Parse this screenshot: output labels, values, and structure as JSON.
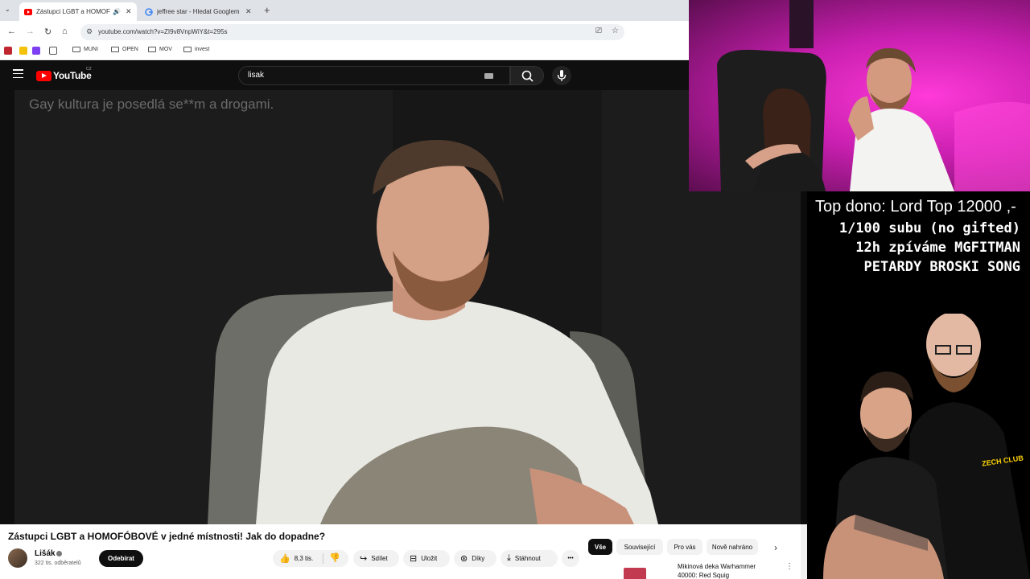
{
  "browser": {
    "tabs": [
      {
        "title": "Zástupci LGBT a HOMOFÓBOVÉ",
        "active": true
      },
      {
        "title": "jeffree star - Hledat Googlem",
        "active": false
      }
    ],
    "tab_list_icon": "chevron-down-icon",
    "new_tab_label": "+",
    "url": "youtube.com/watch?v=ZI9v8VnpWiY&t=295s",
    "bookmarks": [
      "MUNI",
      "OPEN",
      "MOV",
      "invest"
    ],
    "accent_colors": {
      "youtube_red": "#ff0000",
      "tab_bar": "#dfe3e8"
    }
  },
  "youtube": {
    "logo_text": "YouTube",
    "country_code": "CZ",
    "search_value": "lisak",
    "video_caption": "Gay kultura je posedlá se**m a drogami.",
    "video_title": "Zástupci LGBT a HOMOFÓBOVÉ v jedné místnosti! Jak do dopadne?",
    "channel_name": "Lišák",
    "subscriber_count": "322 tis. odběratelů",
    "subscribe_label": "Odebírat",
    "like_count": "8,3 tis.",
    "share_label": "Sdílet",
    "save_label": "Uložit",
    "thanks_label": "Díky",
    "download_label": "Stáhnout",
    "more_label": "•••",
    "chips": [
      "Vše",
      "Související",
      "Pro vás",
      "Nově nahráno"
    ],
    "recommendation_title": "Mikinová deka Warhammer 40000: Red Squig"
  },
  "stream_overlay": {
    "top_dono": "Top dono: Lord Top 12000 ,-",
    "goals": [
      "1/100 subu (no gifted)",
      "12h zpíváme MGFITMAN",
      "PETARDY BROSKI SONG"
    ],
    "shirt_brand": "ZECH CLUB",
    "accent_color": "#ff3ad8"
  }
}
